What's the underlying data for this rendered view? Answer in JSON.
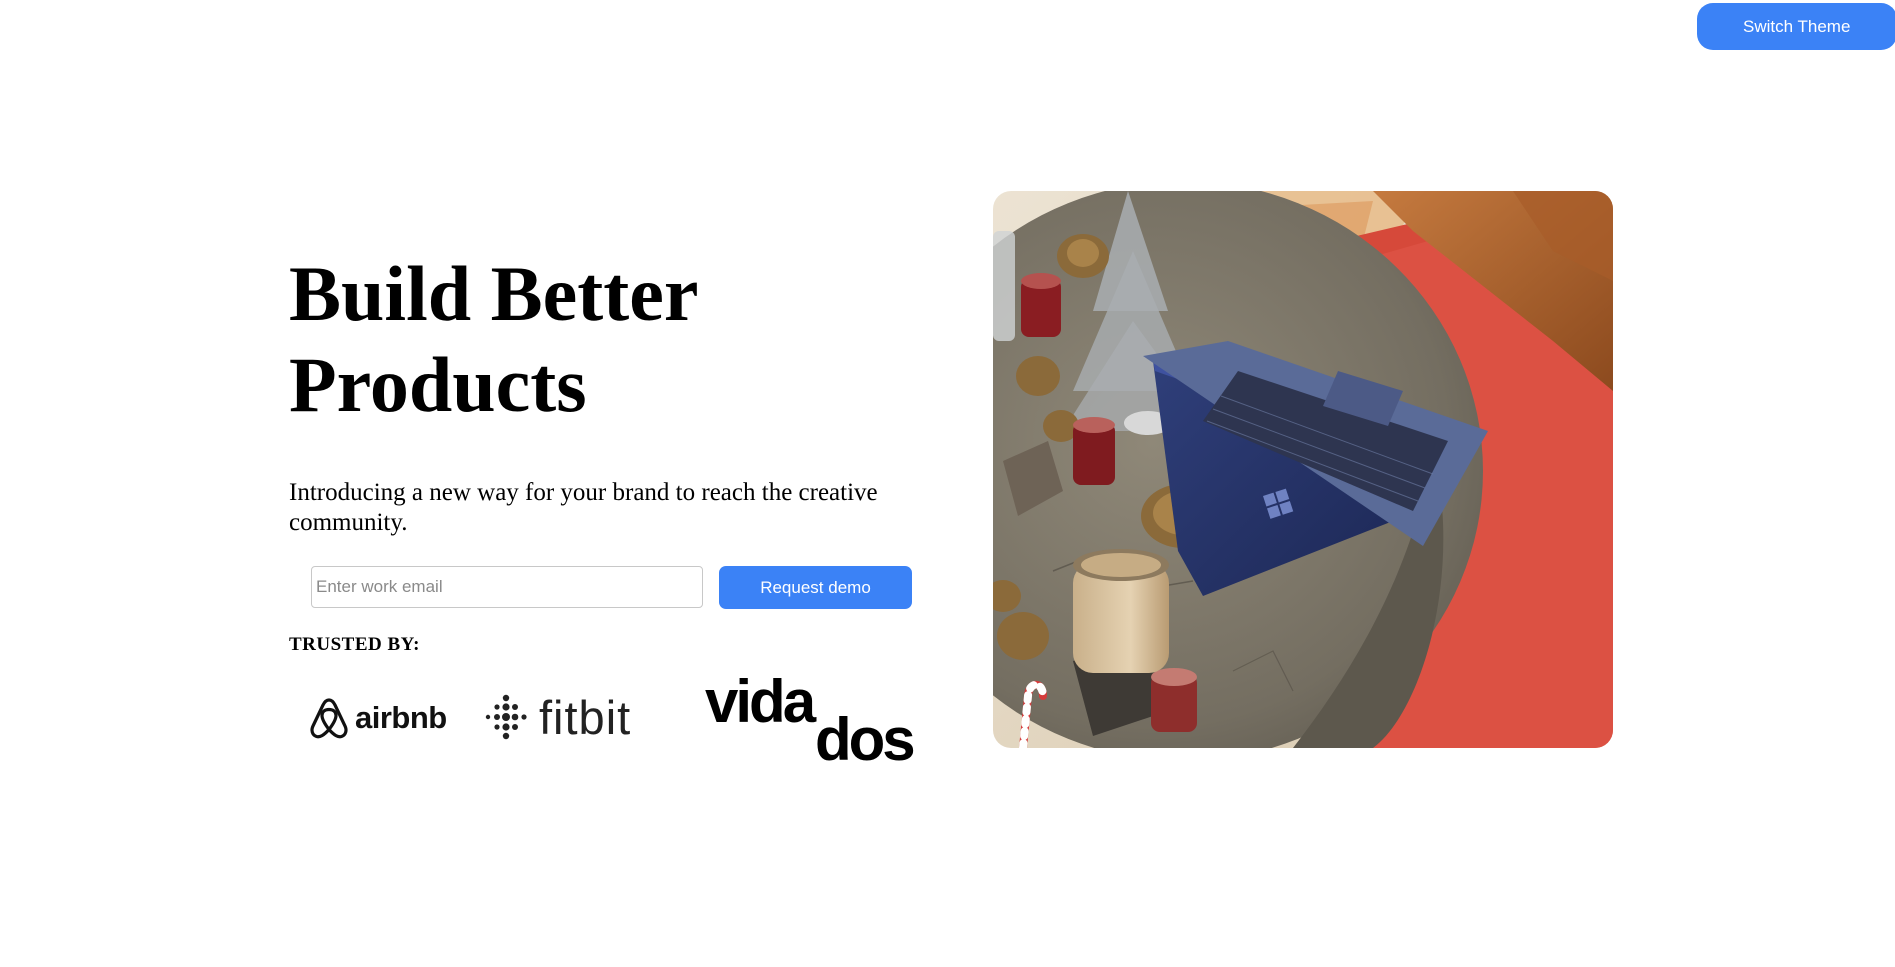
{
  "header": {
    "switch_theme_label": "Switch Theme"
  },
  "hero": {
    "title": "Build Better Products",
    "subtitle": "Introducing a new way for your brand to reach the creative community.",
    "email_placeholder": "Enter work email",
    "email_value": "",
    "cta_label": "Request demo",
    "image_alt": "Laptop on a round concrete table with pine cones, candles and a red rug"
  },
  "trusted": {
    "heading": "TRUSTED BY:",
    "logos": [
      {
        "name": "airbnb",
        "icon": "airbnb-logo"
      },
      {
        "name": "fitbit",
        "icon": "fitbit-logo"
      },
      {
        "name": "vidados",
        "icon": "vidados-logo"
      }
    ]
  },
  "colors": {
    "accent": "#3b82f6",
    "text": "#000000",
    "background": "#ffffff"
  }
}
